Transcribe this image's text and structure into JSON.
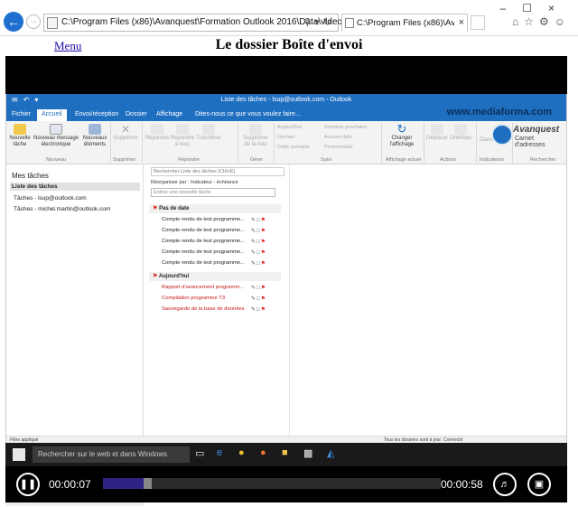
{
  "browser": {
    "url": "C:\\Program Files (x86)\\Avanquest\\Formation Outlook 2016\\Data\\video\\12.htm",
    "tab_title": "C:\\Program Files (x86)\\Avan..."
  },
  "page": {
    "menu_link": "Menu",
    "title": "Le dossier Boîte d'envoi"
  },
  "outlook": {
    "window_title": "Liste des tâches - lsup@outlook.com - Outlook",
    "tabs": [
      "Fichier",
      "Accueil",
      "Envoi/réception",
      "Dossier",
      "Affichage",
      "Dites-nous ce que vous voulez faire..."
    ],
    "watermark": "www.mediaforma.com",
    "logo": {
      "name": "Avanquest",
      "sub": "Carnet d'adresses"
    },
    "ribbon": {
      "nouveau": {
        "b1": "Nouvelle tâche",
        "b2": "Nouveau message électronique",
        "b3": "Nouveaux éléments",
        "group": "Nouveau"
      },
      "supprimer": {
        "b1": "Supprimer",
        "group": "Supprimer"
      },
      "repondre": {
        "b1": "Répondre",
        "b2": "Répondre à tous",
        "b3": "Transférer",
        "group": "Répondre"
      },
      "gerer": {
        "b1": "Supprimer de la liste",
        "group": "Gérer"
      },
      "suivi": {
        "s1": "Aujourd'hui",
        "s2": "Demain",
        "s3": "Cette semaine",
        "s4": "Semaine prochaine",
        "s5": "Aucune date",
        "s6": "Personnalisé",
        "group": "Suivi"
      },
      "affichage": {
        "b1": "Changer l'affichage",
        "group": "Affichage actuel"
      },
      "actions": {
        "b1": "Déplacer",
        "b2": "OneNote",
        "group": "Actions"
      },
      "indicateurs": {
        "b1": "Classer",
        "group": "Indicateurs"
      },
      "rechercher": {
        "group": "Rechercher"
      }
    },
    "left": {
      "header": "Mes tâches",
      "items": [
        "Liste des tâches",
        "Tâches - lsup@outlook.com",
        "Tâches - michel.martin@outlook.com"
      ]
    },
    "list": {
      "search_placeholder": "Rechercher Liste des tâches (Ctrl+E)",
      "sort": "Réorganiser par : Indicateur : échéance",
      "new_task": "Entrez une nouvelle tâche",
      "group1": "Pas de date",
      "group2": "Aujourd'hui",
      "tasks1": [
        "Compte rendu de test programme...",
        "Compte rendu de test programme...",
        "Compte rendu de test programme...",
        "Compte rendu de test programme...",
        "Compte rendu de test programme..."
      ],
      "tasks2": [
        "Rapport d'avancement programm...",
        "Compilation programme T3",
        "Sauvegarde de la base de données"
      ]
    },
    "status": {
      "left": "Filtre appliqué",
      "sync": "Tous les dossiers sont à jour.",
      "conn": "Connecté"
    }
  },
  "taskbar": {
    "search": "Rechercher sur le web et dans Windows"
  },
  "player": {
    "current": "00:00:07",
    "total": "00:00:58",
    "progress": 0.12
  }
}
